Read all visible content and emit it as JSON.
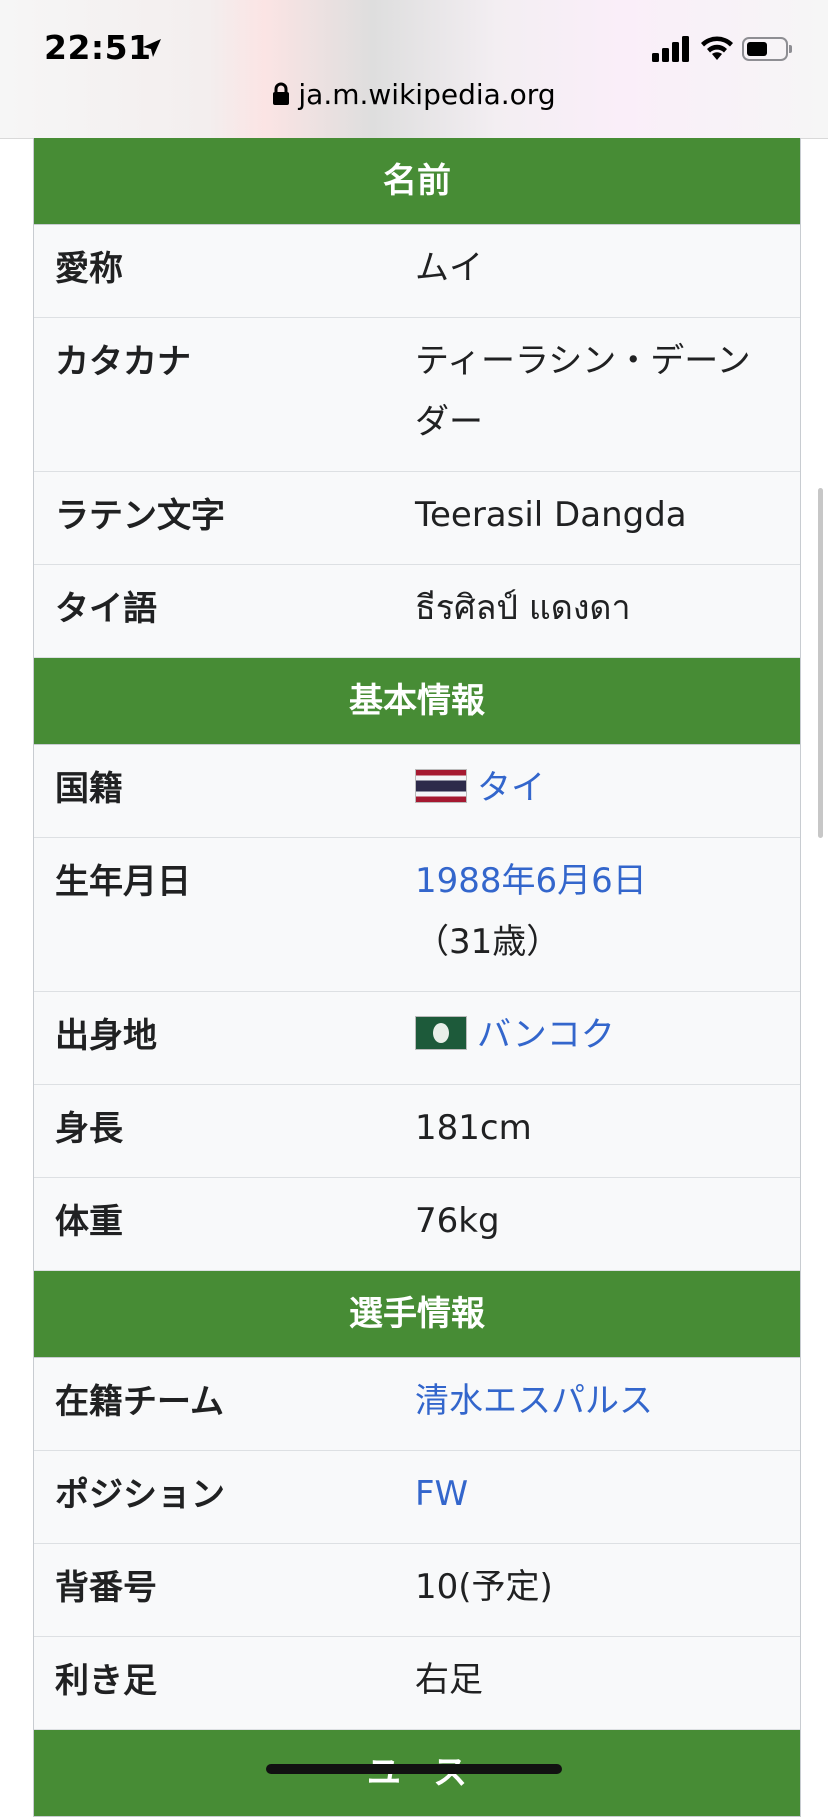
{
  "status_bar": {
    "time": "22:51",
    "url": "ja.m.wikipedia.org"
  },
  "infobox": {
    "sections": [
      {
        "title": "名前",
        "rows": [
          {
            "label": "愛称",
            "value": "ムイ"
          },
          {
            "label": "カタカナ",
            "value": "ティーラシン・デーンダー"
          },
          {
            "label": "ラテン文字",
            "value": "Teerasil Dangda"
          },
          {
            "label": "タイ語",
            "value": "ธีรศิลป์ แดงดา"
          }
        ]
      },
      {
        "title": "基本情報",
        "rows": [
          {
            "label": "国籍",
            "value": "タイ"
          },
          {
            "label": "生年月日",
            "value": "1988年6月6日",
            "value_suffix": "（31歳）"
          },
          {
            "label": "出身地",
            "value": "バンコク"
          },
          {
            "label": "身長",
            "value": "181cm"
          },
          {
            "label": "体重",
            "value": "76kg"
          }
        ]
      },
      {
        "title": "選手情報",
        "rows": [
          {
            "label": "在籍チーム",
            "value": "清水エスパルス"
          },
          {
            "label": "ポジション",
            "value": "FW"
          },
          {
            "label": "背番号",
            "value": "10(予定)"
          },
          {
            "label": "利き足",
            "value": "右足"
          }
        ]
      },
      {
        "title": "ユース"
      }
    ]
  },
  "colors": {
    "header_green": "#478c35",
    "link_blue": "#3366cc",
    "row_bg": "#f8f9fa"
  }
}
